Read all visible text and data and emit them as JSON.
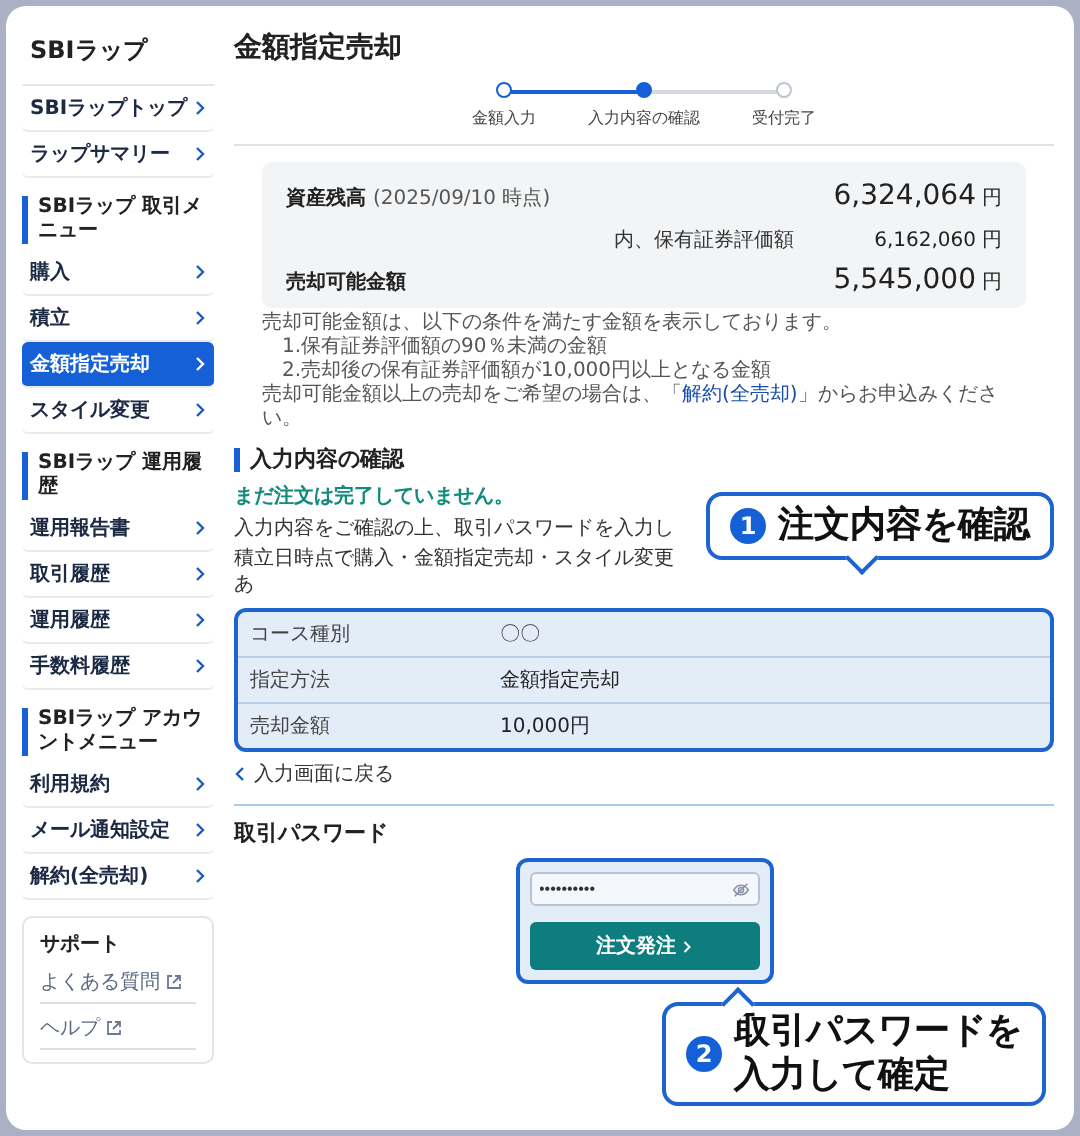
{
  "sidebar": {
    "title": "SBIラップ",
    "sections": [
      {
        "items": [
          {
            "label": "SBIラップトップ",
            "selected": false
          },
          {
            "label": "ラップサマリー",
            "selected": false
          }
        ]
      },
      {
        "heading": "SBIラップ 取引メニュー",
        "items": [
          {
            "label": "購入",
            "selected": false
          },
          {
            "label": "積立",
            "selected": false
          },
          {
            "label": "金額指定売却",
            "selected": true
          },
          {
            "label": "スタイル変更",
            "selected": false
          }
        ]
      },
      {
        "heading": "SBIラップ 運用履歴",
        "items": [
          {
            "label": "運用報告書",
            "selected": false
          },
          {
            "label": "取引履歴",
            "selected": false
          },
          {
            "label": "運用履歴",
            "selected": false
          },
          {
            "label": "手数料履歴",
            "selected": false
          }
        ]
      },
      {
        "heading": "SBIラップ アカウントメニュー",
        "items": [
          {
            "label": "利用規約",
            "selected": false
          },
          {
            "label": "メール通知設定",
            "selected": false
          },
          {
            "label": "解約(全売却)",
            "selected": false
          }
        ]
      }
    ],
    "support": {
      "title": "サポート",
      "links": [
        "よくある質問",
        "ヘルプ"
      ]
    }
  },
  "page": {
    "title": "金額指定売却"
  },
  "stepper": [
    {
      "label": "金額入力",
      "completed": true,
      "selected": false
    },
    {
      "label": "入力内容の確認",
      "completed": false,
      "selected": true
    },
    {
      "label": "受付完了",
      "completed": false,
      "selected": false
    }
  ],
  "summary": {
    "balance_label": "資産残高",
    "balance_date": "(2025/09/10 時点)",
    "balance": "6,324,064",
    "securities_label": "内、保有証券評価額",
    "securities": "6,162,060",
    "sellable_label": "売却可能金額",
    "sellable": "5,545,000",
    "balance_unit": "円",
    "securities_unit": "円",
    "sellable_unit": "円"
  },
  "notes": [
    {
      "text": "売却可能金額は、以下の条件を満たす金額を表示しております。",
      "indent": false
    },
    {
      "text": "1.保有証券評価額の90％未満の金額",
      "indent": true
    },
    {
      "text": "2.売却後の保有証券評価額が10,000円以上となる金額",
      "indent": true
    }
  ],
  "notes_last": {
    "before": "売却可能金額以上の売却をご希望の場合は、「",
    "link": "解約(全売却)",
    "after": "」からお申込みください。"
  },
  "confirm": {
    "heading": "入力内容の確認",
    "warning": "まだ注文は完了していません。",
    "instructions": [
      "入力内容をご確認の上、取引パスワードを入力し",
      "積立日時点で購入・金額指定売却・スタイル変更あ"
    ],
    "rows": [
      {
        "label": "コース種別",
        "value": "〇〇"
      },
      {
        "label": "指定方法",
        "value": "金額指定売却"
      },
      {
        "label": "売却金額",
        "value": "10,000円"
      }
    ],
    "back_link": "入力画面に戻る"
  },
  "password": {
    "heading": "取引パスワード",
    "value": "••••••••••",
    "button": "注文発注"
  },
  "callouts": [
    {
      "number": "1",
      "lines": [
        "注文内容を確認"
      ]
    },
    {
      "number": "2",
      "lines": [
        "取引パスワードを",
        "入力して確定"
      ]
    }
  ]
}
